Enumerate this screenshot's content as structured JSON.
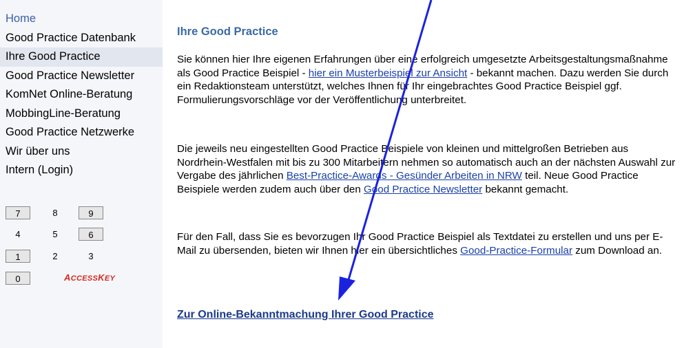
{
  "nav": {
    "items": [
      {
        "label": "Home"
      },
      {
        "label": "Good Practice Datenbank"
      },
      {
        "label": "Ihre Good Practice"
      },
      {
        "label": "Good Practice Newsletter"
      },
      {
        "label": "KomNet Online-Beratung"
      },
      {
        "label": "MobbingLine-Beratung"
      },
      {
        "label": "Good Practice Netzwerke"
      },
      {
        "label": "Wir über uns"
      },
      {
        "label": "Intern (Login)"
      }
    ],
    "active_index": 2
  },
  "keypad": {
    "keys": [
      "7",
      "8",
      "9",
      "4",
      "5",
      "6",
      "1",
      "2",
      "3",
      "0"
    ],
    "accesskey_label_first": "A",
    "accesskey_label_rest1": "CCESS",
    "accesskey_label_k": "K",
    "accesskey_label_rest2": "EY"
  },
  "main": {
    "title": "Ihre Good Practice",
    "p1": {
      "t1": "Sie können hier Ihre eigenen Erfahrungen über eine erfolgreich umgesetzte Arbeitsgestaltungsmaßnahme als Good Practice Beispiel - ",
      "link": "hier ein Musterbeispiel zur Ansicht",
      "t2": " - bekannt machen. Dazu werden Sie durch ein Redaktionsteam unterstützt, welches Ihnen für Ihr eingebrachtes Good Practice Beispiel ggf. Formulierungsvorschläge vor der Veröffentlichung unterbreitet."
    },
    "p2": {
      "t1": "Die jeweils neu eingestellten Good Practice Beispiele von kleinen und mittelgroßen Betrieben aus Nordrhein-Westfalen mit bis zu 300 Mitarbeitern nehmen so automatisch auch an der nächsten Auswahl zur Vergabe des jährlichen ",
      "link1": "Best-Practice-Awards - Gesünder Arbeiten in NRW",
      "t2": " teil. Neue Good Practice Beispiele werden zudem auch über den ",
      "link2": "Good Practice Newsletter",
      "t3": " bekannt gemacht."
    },
    "p3": {
      "t1": "Für den Fall, dass Sie es bevorzugen Ihr Good Practice Beispiel als Textdatei zu erstellen und uns per E-Mail zu übersenden, bieten wir Ihnen hier ein übersichtliches ",
      "link": "Good-Practice-Formular",
      "t2": " zum Download an."
    },
    "cta": "Zur Online-Bekanntmachung Ihrer Good Practice"
  },
  "annotation": {
    "arrow_color": "#1a22e0"
  }
}
